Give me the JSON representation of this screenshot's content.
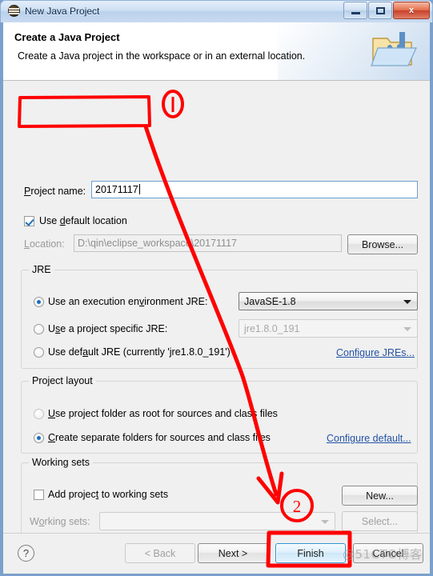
{
  "window": {
    "title": "New Java Project",
    "app_icon": "eclipse-icon",
    "buttons": {
      "minimize": "minimize-icon",
      "maximize": "maximize-icon",
      "close": "x"
    }
  },
  "header": {
    "title": "Create a Java Project",
    "subtitle": "Create a Java project in the workspace or in an external location.",
    "icon": "java-project-folder-icon"
  },
  "form": {
    "project_name": {
      "label": "Project name:",
      "value": "20171117"
    },
    "use_default_location": {
      "label": "Use default location",
      "checked": true
    },
    "location": {
      "label": "Location:",
      "value": "D:\\qin\\eclipse_workspace\\20171117",
      "enabled": false
    },
    "browse_button": "Browse..."
  },
  "jre": {
    "group_title": "JRE",
    "options": [
      {
        "label": "Use an execution environment JRE:",
        "selected": true
      },
      {
        "label": "Use a project specific JRE:",
        "selected": false
      },
      {
        "label": "Use default JRE (currently 'jre1.8.0_191')",
        "selected": false
      }
    ],
    "execution_env_value": "JavaSE-1.8",
    "project_jre_value": "jre1.8.0_191",
    "configure_link": "Configure JREs..."
  },
  "project_layout": {
    "group_title": "Project layout",
    "options": [
      {
        "label": "Use project folder as root for sources and class files",
        "selected": false
      },
      {
        "label": "Create separate folders for sources and class files",
        "selected": true
      }
    ],
    "configure_link": "Configure default..."
  },
  "working_sets": {
    "group_title": "Working sets",
    "add_checkbox": {
      "label": "Add project to working sets",
      "checked": false
    },
    "new_button": "New...",
    "sets_label": "Working sets:",
    "sets_value": "",
    "select_button": "Select..."
  },
  "footer": {
    "help_icon": "question-mark-icon",
    "back": "< Back",
    "next": "Next >",
    "finish": "Finish",
    "cancel": "Cancel"
  },
  "annotations": {
    "marker_one": "1",
    "marker_two": "2",
    "color": "#FF0000",
    "watermark": "@51CTO博客"
  }
}
